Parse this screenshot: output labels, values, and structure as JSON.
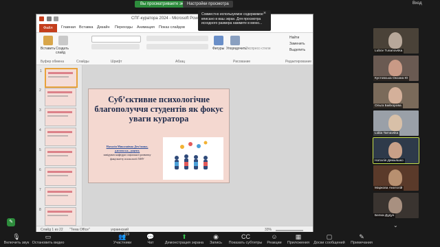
{
  "top": {
    "viewing_badge": "Вы просматриваете экран Наталія Демьяшко",
    "view_options": "Настройки просмотра",
    "exit": "Вход"
  },
  "ppt": {
    "window_title": "СПГ-куратора 2024 - Microsoft PowerPoint",
    "tabs": [
      "Файл",
      "Главная",
      "Вставка",
      "Дизайн",
      "Переходы",
      "Анимация",
      "Показ слайдов"
    ],
    "ribbon": {
      "paste": "Вставить",
      "new_slide": "Создать слайд",
      "clipboard_group": "Буфер обмена",
      "slides_group": "Слайды",
      "font_group": "Шрифт",
      "paragraph_group": "Абзац",
      "figures": "Фигуры",
      "arrange": "Упорядочить",
      "express_styles": "Экспресс-стили",
      "drawing_group": "Рисование",
      "find": "Найти",
      "replace": "Заменить",
      "select": "Выделить",
      "editing_group": "Редактирование"
    },
    "slide_numbers": [
      "1",
      "2",
      "3",
      "4",
      "5",
      "6",
      "7",
      "8"
    ],
    "slide": {
      "title": "Суб’єктивне психологічне благополуччя студентів як фокус уваги куратора",
      "author_name": "Наталія Миколаївна Демʼяшко,",
      "author_line2": "д.психол.н., доцент,",
      "author_line3": "завідувач кафедри соціальної розвитку",
      "author_line4": "факультету психології ХНУ"
    },
    "status": {
      "slide_count": "Слайд 1 из 22",
      "theme": "\"Тема Office\"",
      "language": "украинский",
      "zoom": "33%"
    }
  },
  "tooltip": {
    "text": "Совместно используемое содержимое вписано в ваш экран. Для просмотра исходного размера нажмите в меню..."
  },
  "participants": [
    {
      "name": "Lubov Tunanovska",
      "skin": "#b8a89a",
      "bg": "#4a4238"
    },
    {
      "name": "Кустовська Оксана Ю",
      "skin": "#c99a86",
      "bg": "#6a5a52"
    },
    {
      "name": "Ольга Байхорова",
      "skin": "#d4b09a",
      "bg": "#7a6a5a"
    },
    {
      "name": "Lidiia Tarnavska",
      "skin": "#d8c0a8",
      "bg": "#9aa0a8"
    },
    {
      "name": "Наталія Демьяшко",
      "skin": "#c8a088",
      "bg": "#2e3a4a"
    },
    {
      "name": "Маркова Анатолій",
      "skin": "#b89070",
      "bg": "#5a3a2a"
    },
    {
      "name": "Белка-Дудун",
      "skin": "#a89080",
      "bg": "#3a3430"
    }
  ],
  "toolbar": {
    "audio": "Включить звук",
    "video": "Остановить видео",
    "participants": "Участники",
    "participants_count": "119",
    "chat": "Чат",
    "share": "Демонстрация экрана",
    "record": "Запись",
    "captions": "Показать субтитры",
    "reactions": "Реакции",
    "apps": "Приложения",
    "whiteboards": "Доски сообщений",
    "notes": "Примечания"
  },
  "colors": {
    "accent_file_tab": "#c43e1c",
    "badge_green": "#2d8c3c",
    "active_speaker": "#c8e04a",
    "slide_bg": "#f4d8d0",
    "slide_title": "#1e2a4a"
  }
}
